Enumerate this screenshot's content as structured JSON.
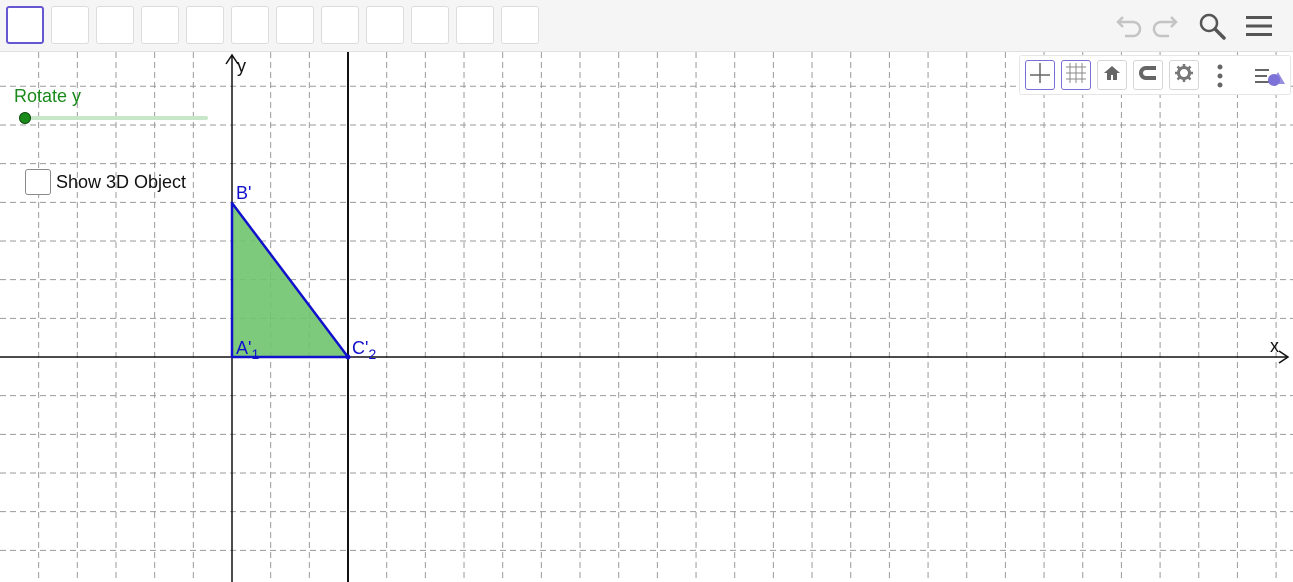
{
  "toolbar": {
    "tool_count": 12,
    "selected_index": 0,
    "actions": {
      "undo_icon": "undo-icon",
      "redo_icon": "redo-icon",
      "search_icon": "search-icon",
      "menu_icon": "hamburger-menu-icon"
    }
  },
  "style_bar": {
    "buttons": [
      "axes-icon",
      "grid-icon",
      "home-icon",
      "magnet-icon",
      "gear-icon",
      "more-vertical-icon",
      "algebra-view-icon"
    ]
  },
  "slider": {
    "label": "Rotate y",
    "value_fraction": 0.0,
    "color": "#1a8a1a"
  },
  "checkbox": {
    "label": "Show 3D Object",
    "checked": false
  },
  "axes": {
    "x_label": "x",
    "y_label": "y"
  },
  "points": {
    "b": "B'",
    "a": "A'",
    "a_sub": "1",
    "c": "C'",
    "c_sub": "2"
  },
  "polygon": {
    "fill": "#6fc46f",
    "stroke": "#1111cc"
  },
  "extra_line_color": "#111111"
}
